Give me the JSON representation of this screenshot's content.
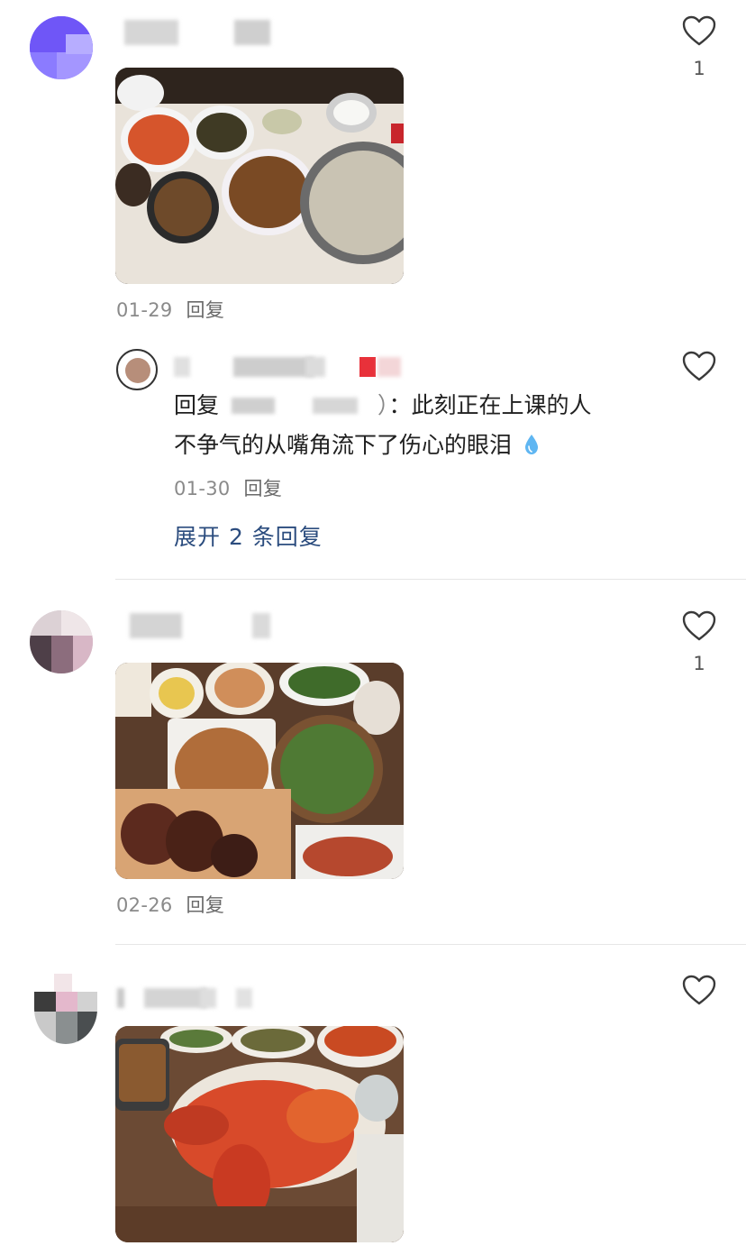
{
  "comments": [
    {
      "date": "01-29",
      "reply_label": "回复",
      "like_count": "1",
      "photo_desc": "dinner-table-dishes",
      "sub_reply": {
        "prefix": "回复",
        "close_paren": "）",
        "text_line1": "：此刻正在上课的人",
        "text_line2": "不争气的从嘴角流下了伤心的眼泪",
        "emoji": "droplet-icon",
        "date": "01-30",
        "reply_label": "回复"
      },
      "expand_label": "展开 2 条回复"
    },
    {
      "date": "02-26",
      "reply_label": "回复",
      "like_count": "1",
      "photo_desc": "steak-salad-spread"
    },
    {
      "photo_desc": "lobster-feast"
    }
  ],
  "colors": {
    "link": "#2b4c7e",
    "meta": "#8a8a8a",
    "divider": "#e6e6e6"
  }
}
